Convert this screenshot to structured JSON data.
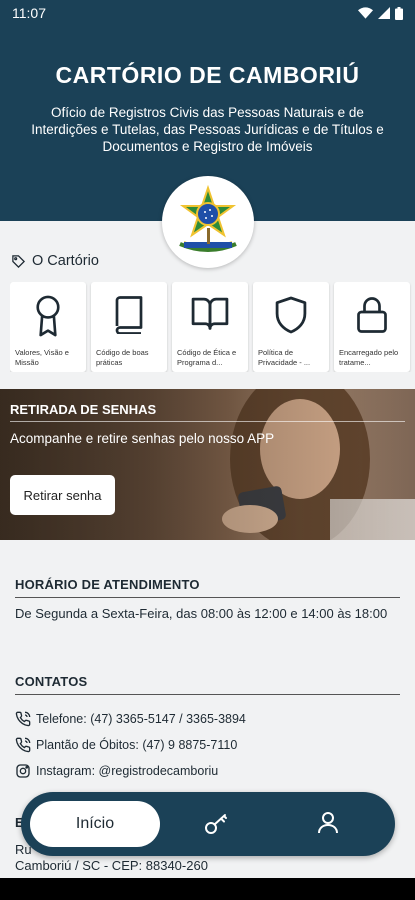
{
  "status_bar": {
    "time": "11:07"
  },
  "header": {
    "title": "CARTÓRIO DE CAMBORIÚ",
    "subtitle": "Ofício de Registros Civis das Pessoas Naturais e de Interdições e Tutelas, das Pessoas Jurídicas e de Títulos e Documentos e Registro de Imóveis"
  },
  "section": {
    "label": "O Cartório",
    "icon": "tag-icon"
  },
  "cards": [
    {
      "label": "Valores, Visão e Missão",
      "icon": "award-icon"
    },
    {
      "label": "Código de boas práticas",
      "icon": "book-icon"
    },
    {
      "label": "Código de Ética e Programa d...",
      "icon": "open-book-icon"
    },
    {
      "label": "Política de Privacidade - ...",
      "icon": "shield-icon"
    },
    {
      "label": "Encarregado pelo tratame...",
      "icon": "lock-icon"
    }
  ],
  "banner": {
    "title": "RETIRADA DE SENHAS",
    "subtitle": "Acompanhe e retire senhas pelo nosso APP",
    "button": "Retirar senha"
  },
  "hours": {
    "title": "HORÁRIO DE ATENDIMENTO",
    "text": "De Segunda a Sexta-Feira, das 08:00 às 12:00 e 14:00 às 18:00"
  },
  "contacts": {
    "title": "CONTATOS",
    "phone": "Telefone: (47) 3365-5147 / 3365-3894",
    "duty": "Plantão de Óbitos: (47) 9 8875-7110",
    "instagram": "Instagram: @registrodecamboriu"
  },
  "address": {
    "partial_title": "E",
    "line1": "Ru",
    "line2": "Camboriú / SC - CEP: 88340-260"
  },
  "navbar": {
    "home": "Início",
    "key_icon": "key-icon",
    "user_icon": "user-icon"
  },
  "colors": {
    "primary": "#1b4157",
    "background": "#f1f2f3"
  }
}
